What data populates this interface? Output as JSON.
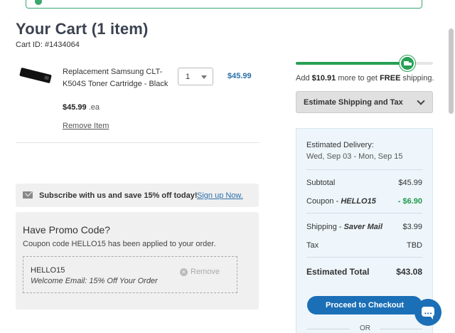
{
  "cart": {
    "title": "Your Cart (1 item)",
    "cart_id_label": "Cart ID: #1434064"
  },
  "item": {
    "name": "Replacement Samsung CLT-K504S Toner Cartridge - Black",
    "unit_price": "$45.99",
    "unit_suffix": ".ea",
    "quantity": "1",
    "line_total": "$45.99",
    "remove_label": "Remove Item",
    "image_icon": "toner-cartridge-image"
  },
  "subscribe": {
    "text": "Subscribe with us and save 15% off today!",
    "link_label": "Sign up Now.",
    "icon": "mail-icon"
  },
  "promo": {
    "title": "Have Promo Code?",
    "applied_message": "Coupon code HELLO15 has been applied to your order.",
    "code": "HELLO15",
    "description": "Welcome Email: 15% Off Your Order",
    "remove_label": "Remove"
  },
  "free_shipping": {
    "progress_fraction": 0.81,
    "prefix": "Add ",
    "amount": "$10.91",
    "middle": " more to get ",
    "free": "FREE",
    "suffix": " shipping.",
    "icon": "truck-icon"
  },
  "estimate_button": {
    "label": "Estimate Shipping and Tax"
  },
  "summary": {
    "delivery_label": "Estimated Delivery:",
    "delivery_range": "Wed, Sep 03 - Mon, Sep 15",
    "subtotal_label": "Subtotal",
    "subtotal_value": "$45.99",
    "coupon_label_prefix": "Coupon - ",
    "coupon_code": "HELLO15",
    "coupon_value": "- $6.90",
    "shipping_label_prefix": "Shipping - ",
    "shipping_method": "Saver Mail",
    "shipping_value": "$3.99",
    "tax_label": "Tax",
    "tax_value": "TBD",
    "total_label": "Estimated Total",
    "total_value": "$43.08",
    "checkout_label": "Proceed to Checkout",
    "or_label": "OR"
  },
  "colors": {
    "brand_blue": "#1b6fb6",
    "success_green": "#27a055",
    "discount_green": "#1f9a4c",
    "title_gray": "#3b4250"
  }
}
